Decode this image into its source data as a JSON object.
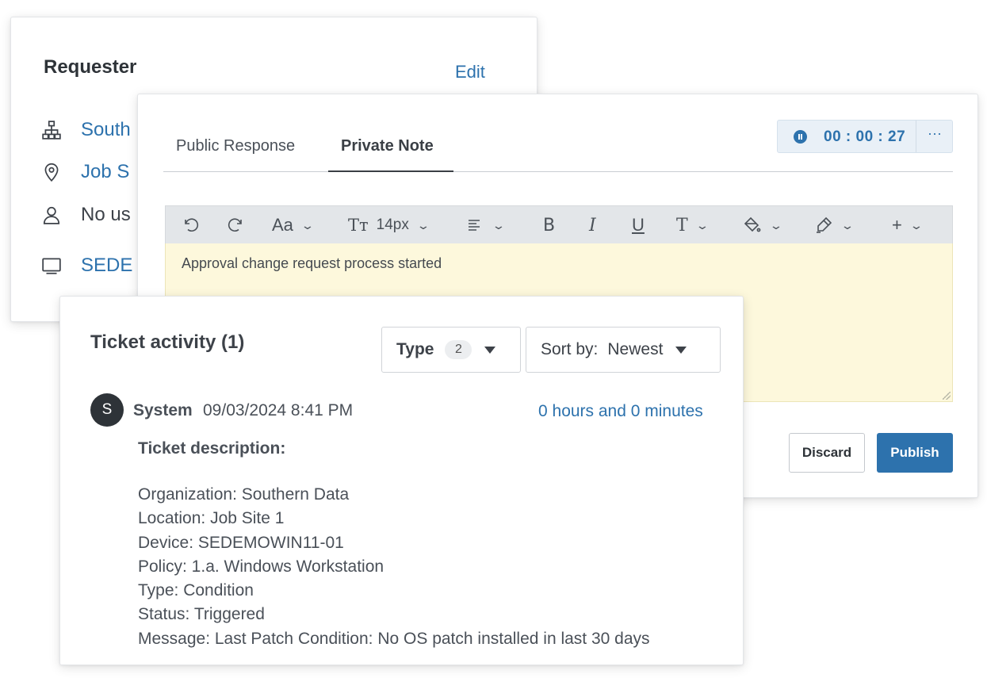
{
  "requester": {
    "title": "Requester",
    "edit_label": "Edit",
    "rows": [
      {
        "icon": "org-chart-icon",
        "text": "South"
      },
      {
        "icon": "location-pin-icon",
        "text": "Job S"
      },
      {
        "icon": "user-icon",
        "text": "No us"
      },
      {
        "icon": "monitor-icon",
        "text": "SEDE"
      }
    ]
  },
  "editor": {
    "tabs": [
      {
        "label": "Public Response",
        "active": false
      },
      {
        "label": "Private Note",
        "active": true
      }
    ],
    "timer": {
      "time": "00 : 00 : 27",
      "more_label": "···"
    },
    "toolbar": {
      "font_label": "Aa",
      "size_label": "14px",
      "bold_label": "B",
      "italic_label": "I",
      "underline_label": "U",
      "text_label": "T",
      "add_label": "+"
    },
    "note_text": "Approval change request process started",
    "discard_label": "Discard",
    "publish_label": "Publish",
    "accent_color": "#2d72ad",
    "note_bg_color": "#fdf8dc"
  },
  "activity": {
    "title": "Ticket activity (1)",
    "type_filter": {
      "label": "Type",
      "count": "2"
    },
    "sort_filter": {
      "label": "Sort by:",
      "value": "Newest"
    },
    "entries": [
      {
        "avatar_initial": "S",
        "author": "System",
        "date": "09/03/2024 8:41 PM",
        "duration": "0 hours and 0 minutes",
        "description_title": "Ticket description:",
        "lines": [
          "Organization: Southern Data",
          "Location: Job Site 1",
          "Device: SEDEMOWIN11-01",
          "Policy: 1.a. Windows Workstation",
          "Type: Condition",
          "Status: Triggered",
          "Message: Last Patch Condition: No OS patch installed in last 30 days"
        ]
      }
    ]
  }
}
